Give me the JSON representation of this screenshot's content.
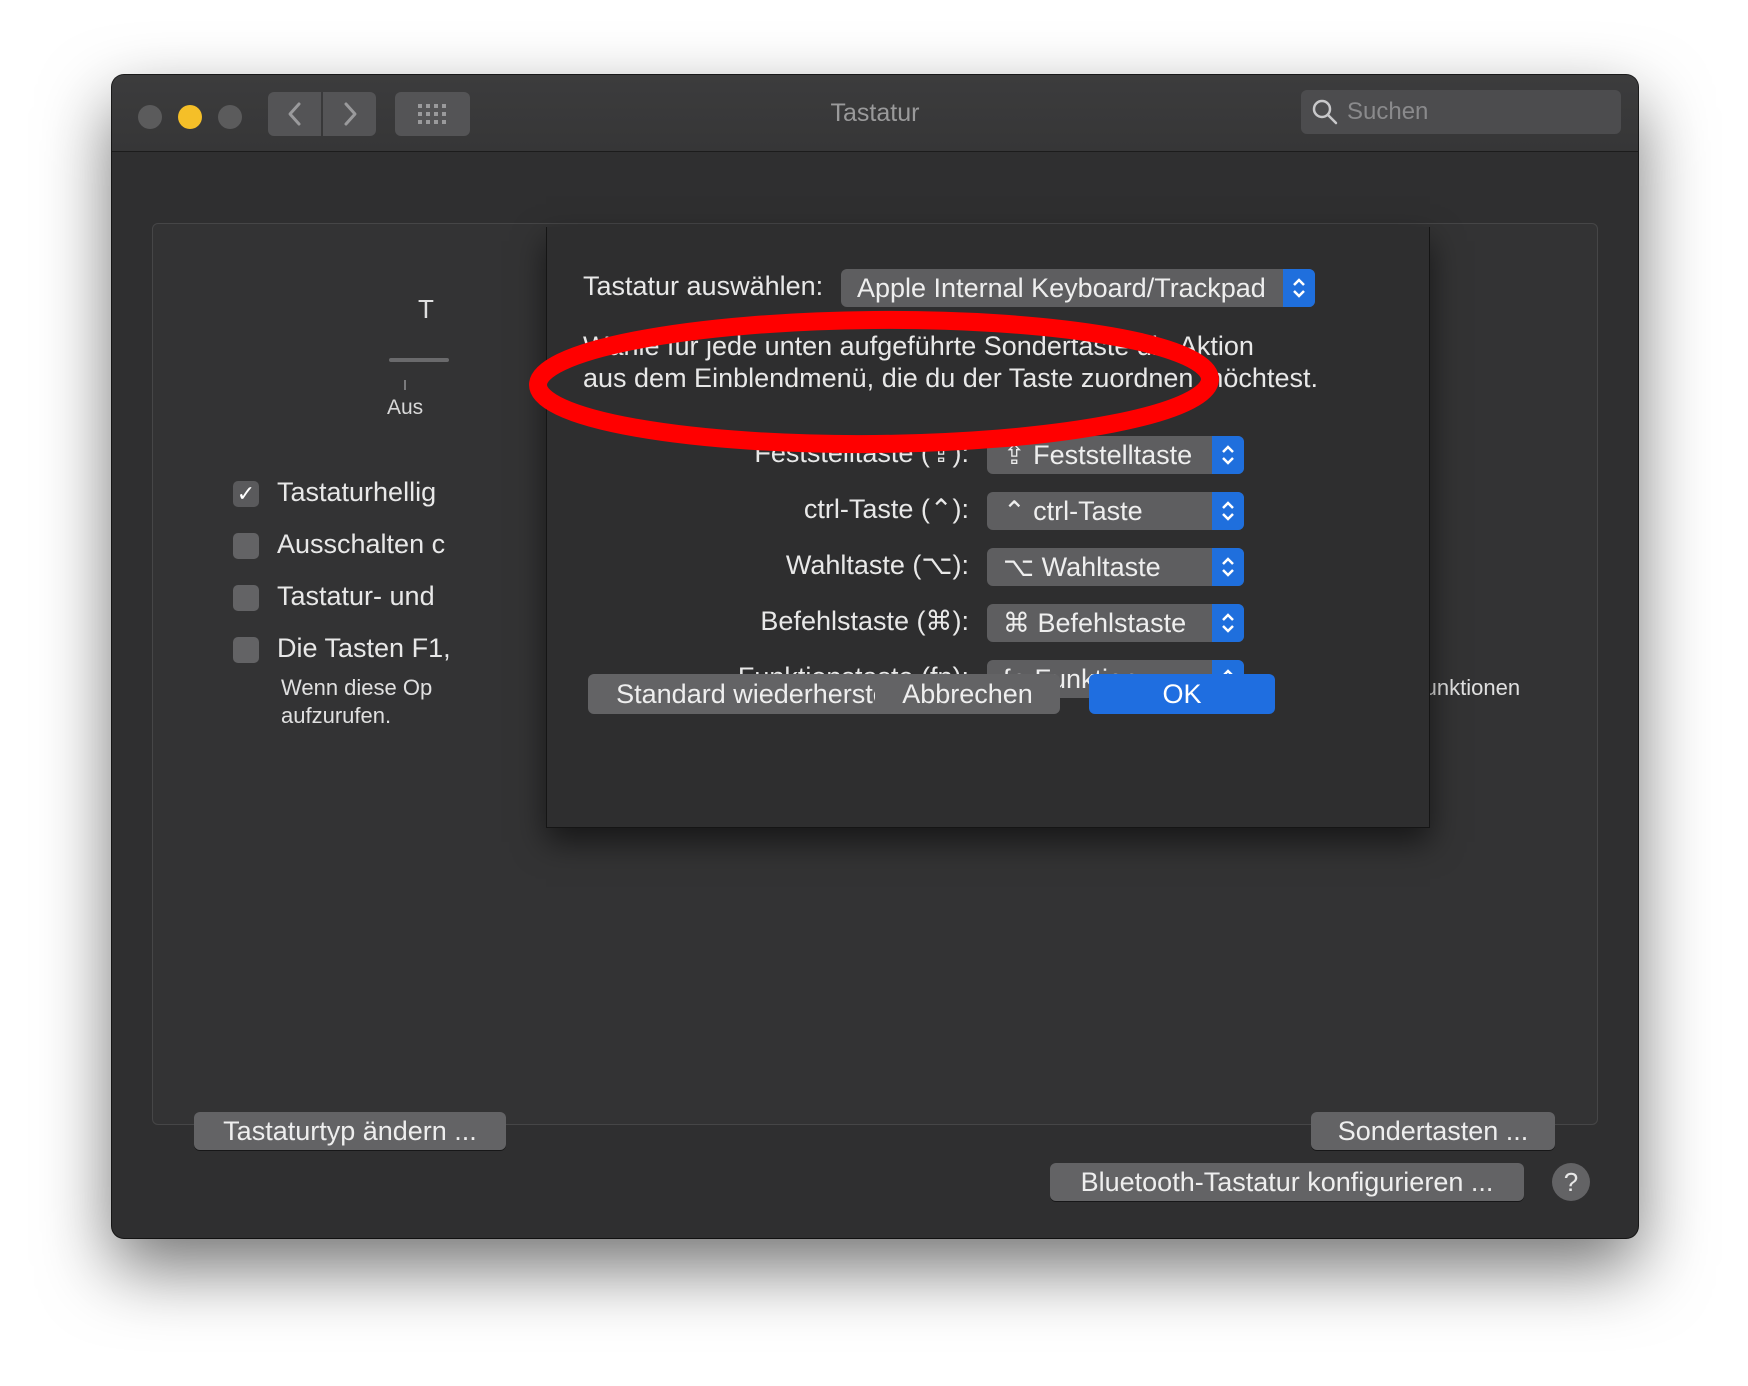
{
  "window": {
    "title": "Tastatur",
    "search_placeholder": "Suchen",
    "accent_color": "#1f6ee0"
  },
  "main": {
    "tab_fragment": "T",
    "slider_label": "Aus",
    "checkboxes": [
      {
        "label": "Tastaturhellig",
        "checked": true
      },
      {
        "label": "Ausschalten c",
        "checked": false
      },
      {
        "label": "Tastatur- und",
        "checked": false
      },
      {
        "label": "Die Tasten F1,",
        "checked": false
      }
    ],
    "note_left_line1": "Wenn diese Op",
    "note_left_line2": "aufzurufen.",
    "note_right": "en Sonderfunktionen",
    "change_type_button": "Tastaturtyp ändern ...",
    "modifier_keys_button": "Sondertasten ...",
    "bluetooth_button": "Bluetooth-Tastatur konfigurieren ...",
    "help_button": "?"
  },
  "sheet": {
    "select_keyboard_label": "Tastatur auswählen:",
    "selected_keyboard": "Apple Internal Keyboard/Trackpad",
    "description_line1": "Wähle für jede unten aufgeführte Sondertaste die Aktion",
    "description_line2": "aus dem Einblendmenü, die du der Taste zuordnen möchtest.",
    "rows": [
      {
        "label": "Feststelltaste (⇪):",
        "value": "⇪ Feststelltaste"
      },
      {
        "label": "ctrl-Taste (⌃):",
        "value": "⌃ ctrl-Taste"
      },
      {
        "label": "Wahltaste (⌥):",
        "value": "⌥ Wahltaste"
      },
      {
        "label": "Befehlstaste (⌘):",
        "value": "⌘ Befehlstaste"
      },
      {
        "label": "Funktionstaste (fn):",
        "value": "fn-Funktion"
      }
    ],
    "restore_button": "Standard wiederherstellen",
    "cancel_button": "Abbrechen",
    "ok_button": "OK"
  },
  "annotation": {
    "type": "red-ellipse-highlight",
    "color": "#ff0000",
    "target": "Feststelltaste"
  }
}
